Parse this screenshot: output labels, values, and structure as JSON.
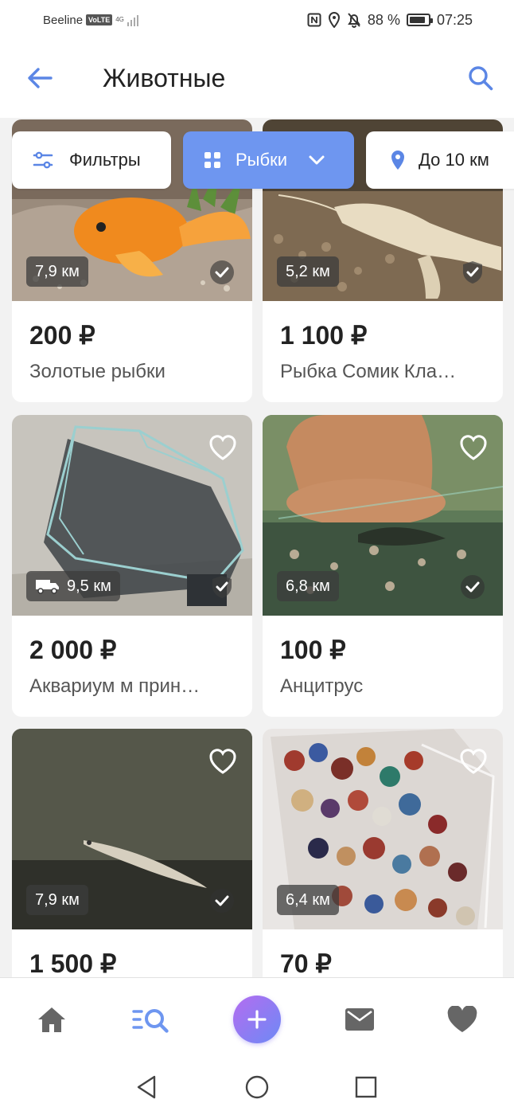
{
  "status_bar": {
    "carrier": "Beeline",
    "volte": "VoLTE",
    "network": "4G",
    "battery_percent": "88 %",
    "time": "07:25",
    "battery_level": 0.88
  },
  "app_bar": {
    "title": "Животные",
    "back_icon": "arrow-left-icon",
    "search_icon": "search-icon"
  },
  "chips": {
    "filters": "Фильтры",
    "category": "Рыбки",
    "distance": "До 10 км"
  },
  "listings": [
    {
      "price": "200 ₽",
      "title": "Золотые рыбки",
      "distance": "7,9 км",
      "delivery": false,
      "badge": "check",
      "favorite": true
    },
    {
      "price": "1 100 ₽",
      "title": "Рыбка Сомик Кла…",
      "distance": "5,2 км",
      "delivery": false,
      "badge": "shield-check",
      "favorite": true
    },
    {
      "price": "2 000 ₽",
      "title": "Аквариум м прин…",
      "distance": "9,5 км",
      "delivery": true,
      "badge": "shield-check",
      "favorite": true
    },
    {
      "price": "100 ₽",
      "title": "Анцитрус",
      "distance": "6,8 км",
      "delivery": false,
      "badge": "check",
      "favorite": true
    },
    {
      "price": "1 500 ₽",
      "title": "",
      "distance": "7,9 км",
      "delivery": false,
      "badge": "check",
      "favorite": true
    },
    {
      "price": "70 ₽",
      "title": "",
      "distance": "6,4 км",
      "delivery": false,
      "badge": "none",
      "favorite": true
    }
  ],
  "bottom_nav": {
    "items": [
      "home-icon",
      "search-list-icon",
      "add-icon",
      "mail-icon",
      "heart-icon"
    ],
    "active": "search-list-icon"
  },
  "colors": {
    "accent": "#6e96f0",
    "fab_gradient_start": "#b46cf0",
    "fab_gradient_end": "#6d8af5",
    "nav_inactive": "#666666"
  }
}
